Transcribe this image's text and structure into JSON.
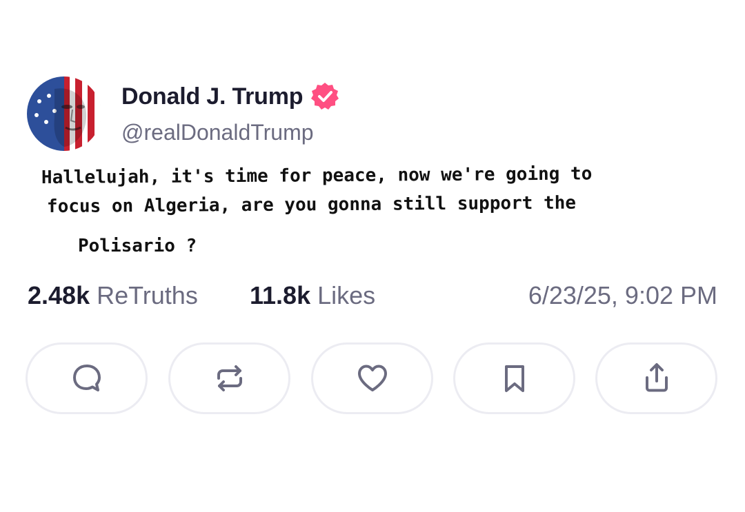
{
  "post": {
    "author": {
      "display_name": "Donald J. Trump",
      "handle": "@realDonaldTrump",
      "verified": true,
      "avatar_icon": "flag-face-avatar"
    },
    "body_lines": [
      "Hallelujah, it's time for peace, now we're going to",
      "focus on Algeria, are you gonna still support the",
      "Polisario ?"
    ],
    "stats": {
      "retruths_count": "2.48k",
      "retruths_label": "ReTruths",
      "likes_count": "11.8k",
      "likes_label": "Likes"
    },
    "timestamp": "6/23/25, 9:02 PM"
  },
  "actions": [
    {
      "name": "reply",
      "icon": "comment-icon"
    },
    {
      "name": "retruth",
      "icon": "repost-icon"
    },
    {
      "name": "like",
      "icon": "heart-icon"
    },
    {
      "name": "bookmark",
      "icon": "bookmark-icon"
    },
    {
      "name": "share",
      "icon": "share-icon"
    }
  ],
  "colors": {
    "verified_badge": "#ff4f82",
    "icon_gray": "#6b6b80",
    "button_border": "#ececf2",
    "name_text": "#1c1c2e"
  }
}
